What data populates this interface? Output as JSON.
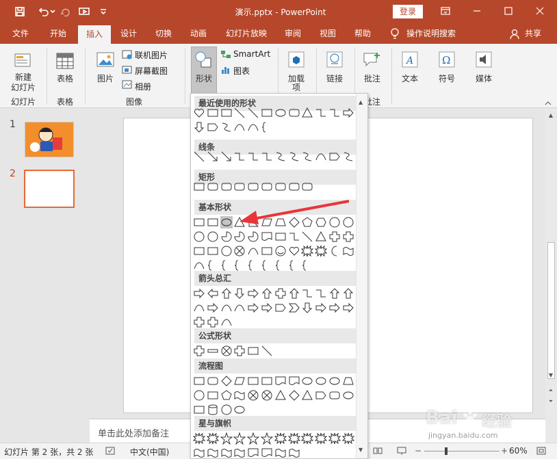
{
  "titlebar": {
    "title": "演示.pptx  -  PowerPoint",
    "login": "登录"
  },
  "tabs": [
    "文件",
    "开始",
    "插入",
    "设计",
    "切换",
    "动画",
    "幻灯片放映",
    "审阅",
    "视图",
    "帮助"
  ],
  "tell_me": "操作说明搜索",
  "share": "共享",
  "ribbon": {
    "new_slide": "新建",
    "new_slide2": "幻灯片",
    "group_slides": "幻灯片",
    "table": "表格",
    "group_table": "表格",
    "picture": "图片",
    "online_pictures": "联机图片",
    "screenshot": "屏幕截图",
    "album": "相册",
    "group_images": "图像",
    "shapes": "形状",
    "smartart": "SmartArt",
    "chart": "图表",
    "addins": "加载",
    "addins2": "项",
    "link": "链接",
    "comment": "批注",
    "group_comments": "批注",
    "text": "文本",
    "symbol": "符号",
    "media": "媒体"
  },
  "slides": [
    {
      "num": "1"
    },
    {
      "num": "2"
    }
  ],
  "notes_placeholder": "单击此处添加备注",
  "status": {
    "slide_info": "幻灯片 第 2 张，共 2 张",
    "language": "中文(中国)",
    "zoom": "60%"
  },
  "dropdown": {
    "sections": [
      "最近使用的形状",
      "线条",
      "矩形",
      "基本形状",
      "箭头总汇",
      "公式形状",
      "流程图",
      "星与旗帜"
    ]
  },
  "watermark": {
    "brand": "Bai",
    "brand2": "经验",
    "url": "jingyan.baidu.com"
  },
  "colors": {
    "accent": "#b7472a",
    "arrow": "#e8353a"
  }
}
